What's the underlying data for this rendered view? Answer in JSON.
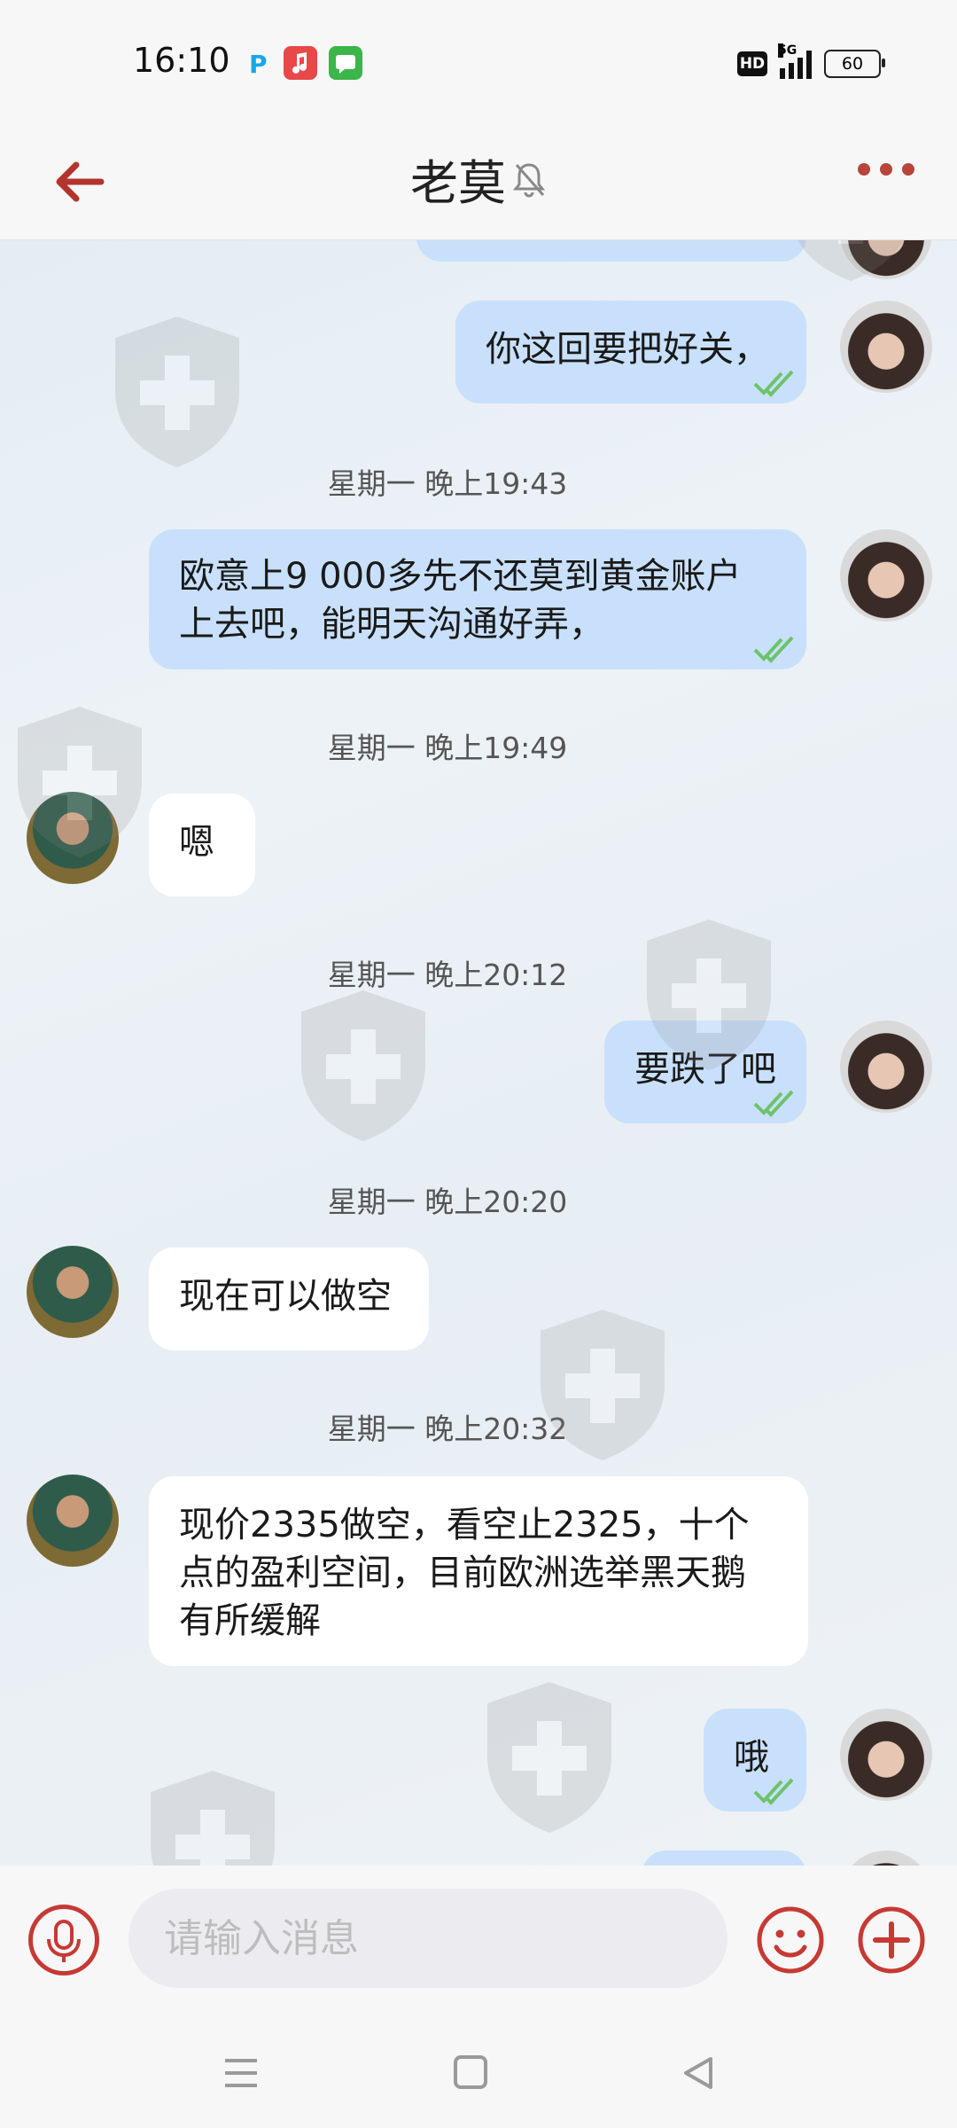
{
  "status_bar": {
    "time": "16:10",
    "network_label": "HD",
    "signal_label": "5G",
    "battery": "60"
  },
  "header": {
    "title": "老莫"
  },
  "messages": [
    {
      "direction": "out",
      "text": "你这回要把好关，",
      "read": true
    },
    {
      "type": "timestamp",
      "text": "星期一 晚上19:43"
    },
    {
      "direction": "out",
      "text_lines": [
        "欧意上9 000多先不还莫到黄金账户",
        "上去吧，能明天沟通好弄，"
      ],
      "read": true
    },
    {
      "type": "timestamp",
      "text": "星期一 晚上19:49"
    },
    {
      "direction": "in",
      "text": "嗯"
    },
    {
      "type": "timestamp",
      "text": "星期一 晚上20:12"
    },
    {
      "direction": "out",
      "text": "要跌了吧",
      "read": true
    },
    {
      "type": "timestamp",
      "text": "星期一 晚上20:20"
    },
    {
      "direction": "in",
      "text": "现在可以做空"
    },
    {
      "type": "timestamp",
      "text": "星期一 晚上20:32"
    },
    {
      "direction": "in",
      "text_lines": [
        "现价2335做空，看空止2325，十个",
        "点的盈利空间，目前欧洲选举黑天鹅",
        "有所缓解"
      ]
    },
    {
      "direction": "out",
      "text": "哦",
      "read": true
    }
  ],
  "input": {
    "placeholder": "请输入消息"
  },
  "colors": {
    "accent": "#c53a33",
    "outgoing_bubble": "#c8e0fb",
    "incoming_bubble": "#ffffff",
    "read_tick": "#6cc36c"
  },
  "icons": {
    "back": "arrow-left-icon",
    "mute": "bell-muted-icon",
    "more": "more-dots-icon",
    "voice": "mic-icon",
    "emoji": "smiley-icon",
    "add": "plus-circle-icon",
    "nav_menu": "menu-icon",
    "nav_home": "home-square-icon",
    "nav_back": "triangle-back-icon"
  }
}
